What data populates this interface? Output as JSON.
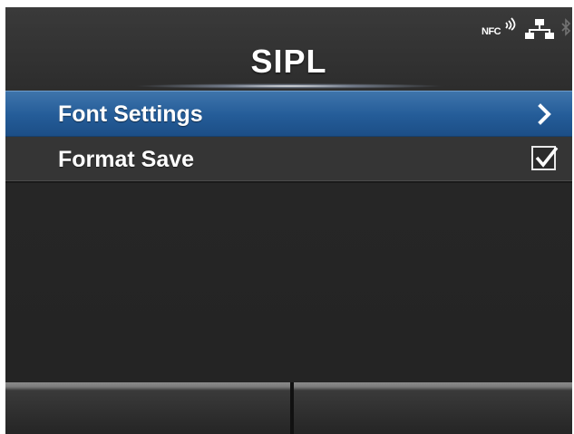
{
  "header": {
    "title": "SIPL",
    "status_icons": {
      "nfc_label": "NFC",
      "nfc_icon": "nfc-icon",
      "lan_icon": "lan-icon",
      "bluetooth_icon": "bluetooth-icon"
    }
  },
  "menu": {
    "items": [
      {
        "label": "Font Settings",
        "selected": true,
        "indicator": "chevron-right-icon"
      },
      {
        "label": "Format Save",
        "selected": false,
        "indicator": "checkbox",
        "checked": true
      }
    ]
  },
  "softkeys": {
    "left_label": "",
    "right_label": ""
  },
  "colors": {
    "selection": "#245c98",
    "background": "#2d2d2d",
    "text": "#ffffff"
  }
}
